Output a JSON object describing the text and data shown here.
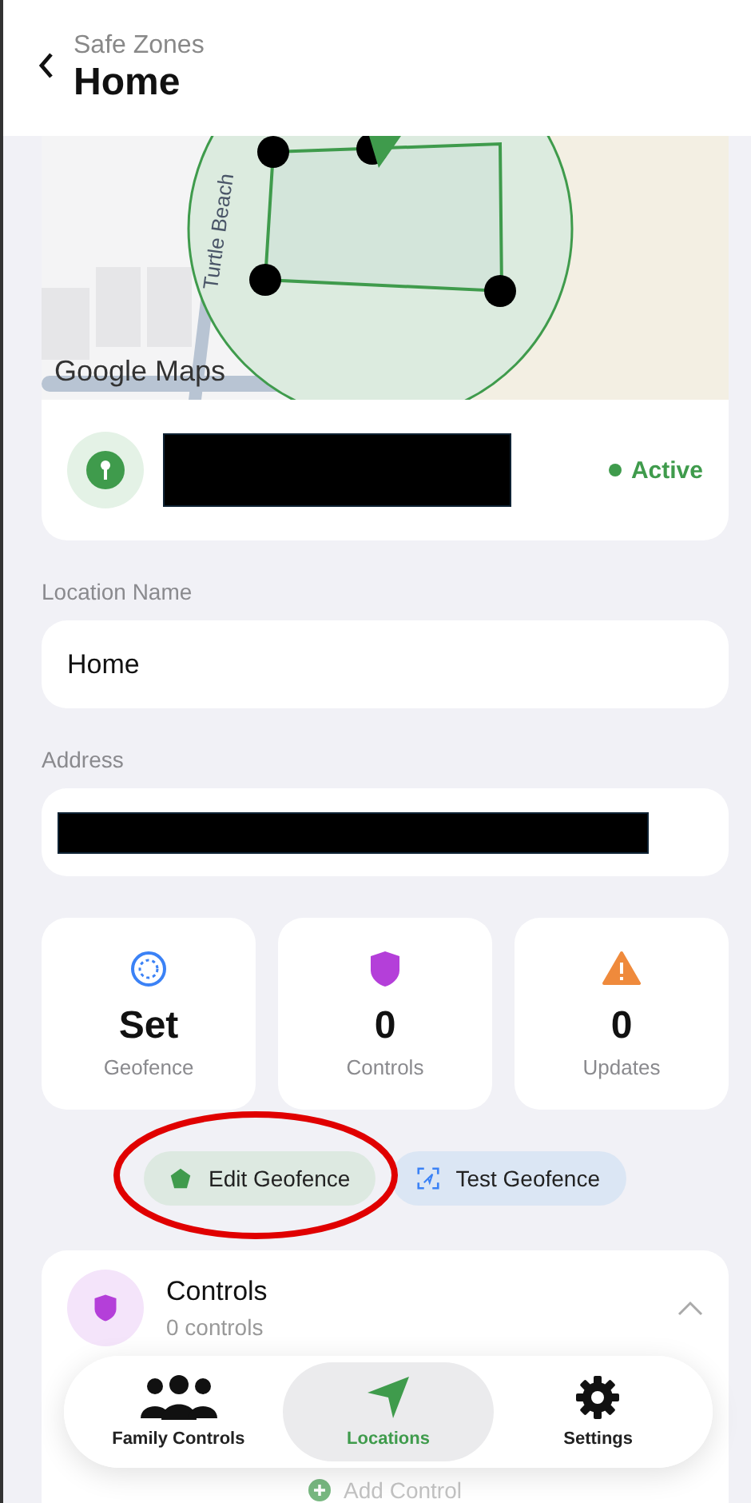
{
  "header": {
    "subtitle": "Safe Zones",
    "title": "Home"
  },
  "map": {
    "street_label": "Turtle Beach",
    "attribution": "Google Maps"
  },
  "location": {
    "status": "Active",
    "active": true
  },
  "fields": [
    {
      "label": "Location Name",
      "value": "Home",
      "redacted": false
    },
    {
      "label": "Address",
      "redacted": true
    }
  ],
  "stats": [
    {
      "kind": "geofence",
      "value": "Set",
      "label": "Geofence"
    },
    {
      "kind": "controls",
      "value": "0",
      "label": "Controls"
    },
    {
      "kind": "updates",
      "value": "0",
      "label": "Updates"
    }
  ],
  "actions": [
    {
      "kind": "edit",
      "label": "Edit Geofence"
    },
    {
      "kind": "test",
      "label": "Test Geofence"
    }
  ],
  "controls_section": {
    "title": "Controls",
    "subtitle": "0 controls",
    "expanded": true,
    "add_label": "Add Control"
  },
  "tab_bar": [
    {
      "kind": "family",
      "label": "Family Controls",
      "selected": false
    },
    {
      "kind": "locations",
      "label": "Locations",
      "selected": true
    },
    {
      "kind": "settings",
      "label": "Settings",
      "selected": false
    }
  ]
}
